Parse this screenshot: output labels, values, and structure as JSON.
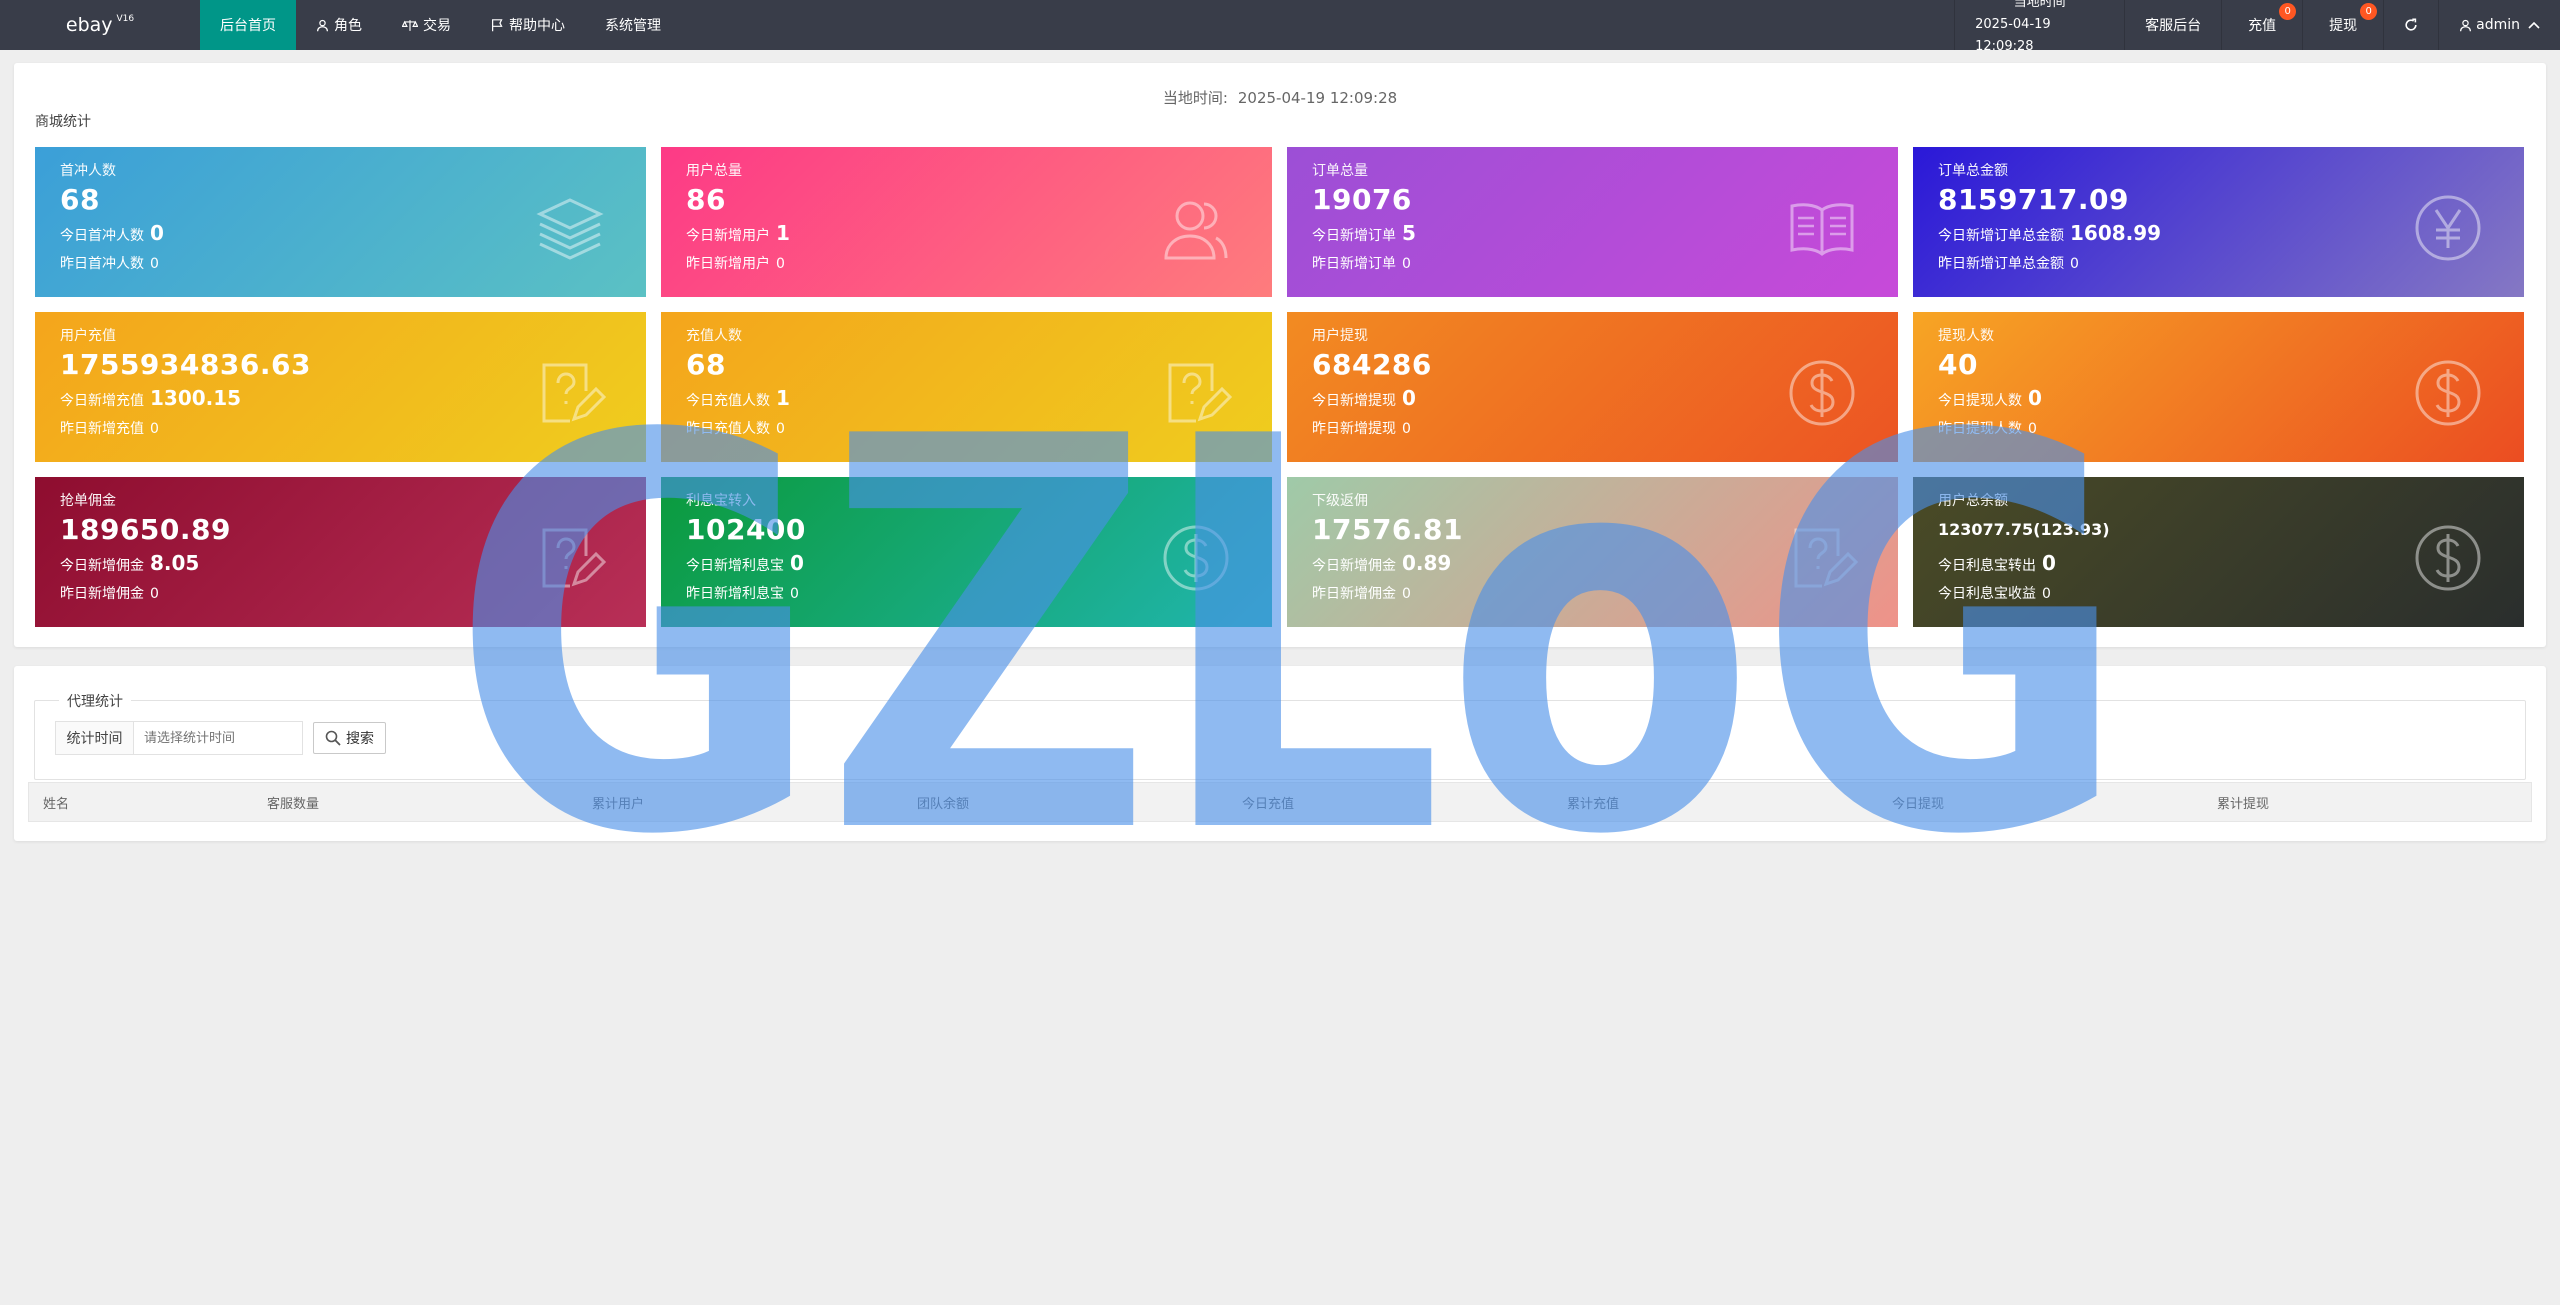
{
  "topbar": {
    "logo": "ebay",
    "logo_sup": "V16",
    "nav": [
      {
        "label": "后台首页",
        "icon": "home-icon"
      },
      {
        "label": "角色",
        "icon": "user-icon"
      },
      {
        "label": "交易",
        "icon": "scale-icon"
      },
      {
        "label": "帮助中心",
        "icon": "flag-icon"
      },
      {
        "label": "系统管理",
        "icon": ""
      }
    ],
    "time_label": "当地时间",
    "time_value": "2025-04-19 12:09:28",
    "service": "客服后台",
    "recharge": "充值",
    "recharge_badge": "0",
    "withdraw": "提现",
    "withdraw_badge": "0",
    "admin": "admin"
  },
  "stats": {
    "time_label": "当地时间:",
    "time_value": "2025-04-19 12:09:28",
    "section_title": "商城统计",
    "tiles": [
      {
        "title": "首冲人数",
        "value": "68",
        "line1": "今日首冲人数",
        "line1_val": "0",
        "line2": "昨日首冲人数",
        "line2_val": "0",
        "icon": "layers-icon",
        "gradient": [
          "#3b9fd8",
          "#5bc1c4"
        ]
      },
      {
        "title": "用户总量",
        "value": "86",
        "line1": "今日新增用户",
        "line1_val": "1",
        "line2": "昨日新增用户",
        "line2_val": "0",
        "icon": "users-icon",
        "gradient": [
          "#fd3a86",
          "#fe7c7d"
        ]
      },
      {
        "title": "订单总量",
        "value": "19076",
        "line1": "今日新增订单",
        "line1_val": "5",
        "line2": "昨日新增订单",
        "line2_val": "0",
        "icon": "book-icon",
        "gradient": [
          "#9c4fd6",
          "#c74ad9"
        ]
      },
      {
        "title": "订单总金额",
        "value": "8159717.09",
        "line1": "今日新增订单总金额",
        "line1_val": "1608.99",
        "line2": "昨日新增订单总金额",
        "line2_val": "0",
        "icon": "yen-icon",
        "gradient": [
          "#2a18d8",
          "#8578c4"
        ]
      },
      {
        "title": "用户充值",
        "value": "1755934836.63",
        "line1": "今日新增充值",
        "line1_val": "1300.15",
        "line2": "昨日新增充值",
        "line2_val": "0",
        "icon": "edit-icon",
        "gradient": [
          "#f4a51c",
          "#efcd1e"
        ]
      },
      {
        "title": "充值人数",
        "value": "68",
        "line1": "今日充值人数",
        "line1_val": "1",
        "line2": "昨日充值人数",
        "line2_val": "0",
        "icon": "edit-icon",
        "gradient": [
          "#f4a51c",
          "#efcd1e"
        ]
      },
      {
        "title": "用户提现",
        "value": "684286",
        "line1": "今日新增提现",
        "line1_val": "0",
        "line2": "昨日新增提现",
        "line2_val": "0",
        "icon": "dollar-icon",
        "gradient": [
          "#f28b22",
          "#ec5423"
        ]
      },
      {
        "title": "提现人数",
        "value": "40",
        "line1": "今日提现人数",
        "line1_val": "0",
        "line2": "昨日提现人数",
        "line2_val": "0",
        "icon": "dollar-icon",
        "gradient": [
          "#f7a524",
          "#eb4d22"
        ]
      },
      {
        "title": "抢单佣金",
        "value": "189650.89",
        "line1": "今日新增佣金",
        "line1_val": "8.05",
        "line2": "昨日新增佣金",
        "line2_val": "0",
        "icon": "edit-icon",
        "gradient": [
          "#8e0d2f",
          "#b82f57"
        ]
      },
      {
        "title": "利息宝转入",
        "value": "102400",
        "line1": "今日新增利息宝",
        "line1_val": "0",
        "line2": "昨日新增利息宝",
        "line2_val": "0",
        "icon": "dollar-icon",
        "gradient": [
          "#0b9a3c",
          "#21b6b0"
        ]
      },
      {
        "title": "下级返佣",
        "value": "17576.81",
        "line1": "今日新增佣金",
        "line1_val": "0.89",
        "line2": "昨日新增佣金",
        "line2_val": "0",
        "icon": "edit-icon",
        "gradient": [
          "#9fcaa8",
          "#ef9289"
        ]
      },
      {
        "title": "用户总余额",
        "value_small": "123077.75(123.93)",
        "line1": "今日利息宝转出",
        "line1_val": "0",
        "line2": "今日利息宝收益",
        "line2_val": "0",
        "icon": "dollar-icon",
        "gradient": [
          "#4a4b26",
          "#2a2e2d"
        ]
      }
    ]
  },
  "agent": {
    "legend": "代理统计",
    "filter_label": "统计时间",
    "filter_placeholder": "请选择统计时间",
    "search_label": "搜索",
    "columns": [
      "姓名",
      "客服数量",
      "累计用户",
      "团队余额",
      "今日充值",
      "累计充值",
      "今日提现",
      "累计提现"
    ]
  },
  "watermark": "GZLoG"
}
